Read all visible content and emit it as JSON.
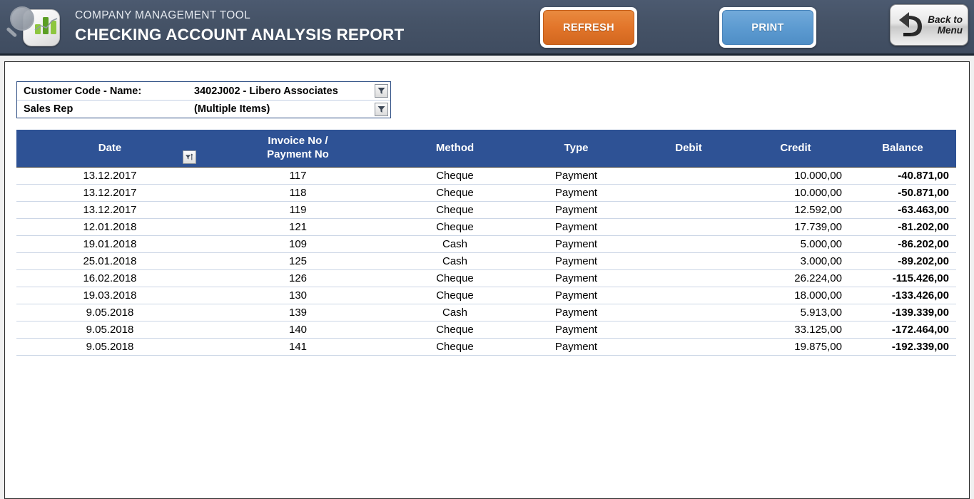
{
  "header": {
    "app_name": "COMPANY MANAGEMENT TOOL",
    "page_title": "CHECKING ACCOUNT ANALYSIS REPORT",
    "logo_icon": "magnifier-bar-chart-icon",
    "refresh_label": "REFRESH",
    "print_label": "PRINT",
    "back_label_line1": "Back to",
    "back_label_line2": "Menu",
    "back_icon": "back-arrow-icon",
    "colors": {
      "bar_background": "#475569",
      "refresh": "#e2752a",
      "print": "#5d9bd1",
      "table_header": "#2e5295"
    }
  },
  "filters": [
    {
      "label": "Customer Code - Name:",
      "value": "3402J002 - Libero Associates",
      "button_icon": "filter-funnel-icon"
    },
    {
      "label": "Sales Rep",
      "value": "(Multiple Items)",
      "button_icon": "filter-funnel-icon"
    }
  ],
  "table": {
    "columns": [
      {
        "label": "Date",
        "button_icon": "sort-ascending-filter-icon"
      },
      {
        "label_line1": "Invoice No /",
        "label_line2": "Payment No",
        "button_icon": "dropdown-arrow-icon"
      },
      {
        "label": "Method",
        "button_icon": "filter-funnel-icon"
      },
      {
        "label": "Type",
        "button_icon": "dropdown-arrow-icon"
      },
      {
        "label": "Debit",
        "button_icon": null
      },
      {
        "label": "Credit",
        "button_icon": null
      },
      {
        "label": "Balance",
        "button_icon": null
      }
    ],
    "rows": [
      {
        "date": "13.12.2017",
        "invoice": "117",
        "method": "Cheque",
        "type": "Payment",
        "debit": "",
        "credit": "10.000,00",
        "balance": "-40.871,00"
      },
      {
        "date": "13.12.2017",
        "invoice": "118",
        "method": "Cheque",
        "type": "Payment",
        "debit": "",
        "credit": "10.000,00",
        "balance": "-50.871,00"
      },
      {
        "date": "13.12.2017",
        "invoice": "119",
        "method": "Cheque",
        "type": "Payment",
        "debit": "",
        "credit": "12.592,00",
        "balance": "-63.463,00"
      },
      {
        "date": "12.01.2018",
        "invoice": "121",
        "method": "Cheque",
        "type": "Payment",
        "debit": "",
        "credit": "17.739,00",
        "balance": "-81.202,00"
      },
      {
        "date": "19.01.2018",
        "invoice": "109",
        "method": "Cash",
        "type": "Payment",
        "debit": "",
        "credit": "5.000,00",
        "balance": "-86.202,00"
      },
      {
        "date": "25.01.2018",
        "invoice": "125",
        "method": "Cash",
        "type": "Payment",
        "debit": "",
        "credit": "3.000,00",
        "balance": "-89.202,00"
      },
      {
        "date": "16.02.2018",
        "invoice": "126",
        "method": "Cheque",
        "type": "Payment",
        "debit": "",
        "credit": "26.224,00",
        "balance": "-115.426,00"
      },
      {
        "date": "19.03.2018",
        "invoice": "130",
        "method": "Cheque",
        "type": "Payment",
        "debit": "",
        "credit": "18.000,00",
        "balance": "-133.426,00"
      },
      {
        "date": "9.05.2018",
        "invoice": "139",
        "method": "Cash",
        "type": "Payment",
        "debit": "",
        "credit": "5.913,00",
        "balance": "-139.339,00"
      },
      {
        "date": "9.05.2018",
        "invoice": "140",
        "method": "Cheque",
        "type": "Payment",
        "debit": "",
        "credit": "33.125,00",
        "balance": "-172.464,00"
      },
      {
        "date": "9.05.2018",
        "invoice": "141",
        "method": "Cheque",
        "type": "Payment",
        "debit": "",
        "credit": "19.875,00",
        "balance": "-192.339,00"
      }
    ]
  }
}
